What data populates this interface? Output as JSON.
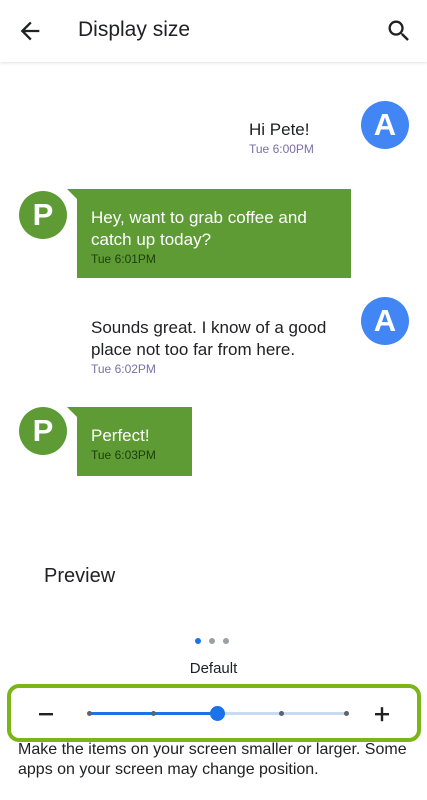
{
  "appbar": {
    "title": "Display size",
    "back_icon": "arrow-back-icon",
    "search_icon": "search-icon"
  },
  "preview": {
    "messages": [
      {
        "sender": "A",
        "text": "Hi Pete!",
        "time": "Tue 6:00PM"
      },
      {
        "sender": "P",
        "text": "Hey, want to grab coffee and catch up today?",
        "time": "Tue 6:01PM"
      },
      {
        "sender": "A",
        "text": "Sounds great. I know of a good place not too far from here.",
        "time": "Tue 6:02PM"
      },
      {
        "sender": "P",
        "text": "Perfect!",
        "time": "Tue 6:03PM"
      }
    ],
    "label": "Preview",
    "page_dots": {
      "count": 3,
      "active": 1
    }
  },
  "size": {
    "current_label": "Default",
    "steps": 4,
    "current_step": 2,
    "decrease_icon": "minus-icon",
    "increase_icon": "plus-icon"
  },
  "description": "Make the items on your screen smaller or larger. Some apps on your screen may change position.",
  "colors": {
    "accent": "#1a73e8",
    "avatar_a": "#4285f4",
    "avatar_p": "#5e9b35",
    "bubble": "#5e9b35",
    "highlight_border": "#7cb518"
  }
}
